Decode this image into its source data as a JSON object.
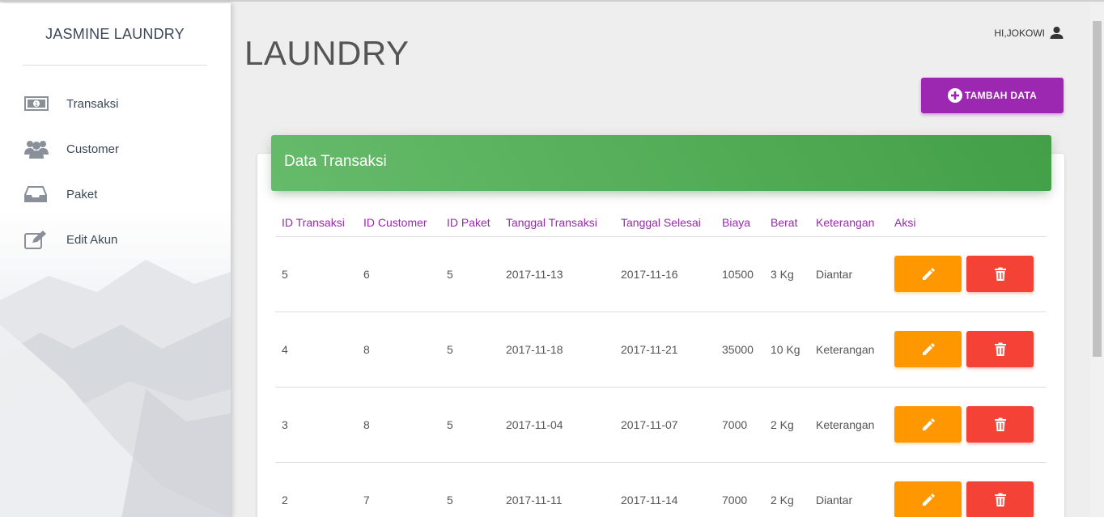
{
  "sidebar": {
    "brand": "JASMINE LAUNDRY",
    "items": [
      {
        "label": "Transaksi",
        "icon": "money-icon"
      },
      {
        "label": "Customer",
        "icon": "users-icon"
      },
      {
        "label": "Paket",
        "icon": "inbox-icon"
      },
      {
        "label": "Edit Akun",
        "icon": "edit-icon"
      }
    ]
  },
  "header": {
    "user_label": "HI,JOKOWI",
    "title": "LAUNDRY",
    "add_button": "TAMBAH DATA"
  },
  "card": {
    "title": "Data Transaksi",
    "columns": [
      "ID Transaksi",
      "ID Customer",
      "ID Paket",
      "Tanggal Transaksi",
      "Tanggal Selesai",
      "Biaya",
      "Berat",
      "Keterangan",
      "Aksi"
    ],
    "rows": [
      [
        "5",
        "6",
        "5",
        "2017-11-13",
        "2017-11-16",
        "10500",
        "3 Kg",
        "Diantar"
      ],
      [
        "4",
        "8",
        "5",
        "2017-11-18",
        "2017-11-21",
        "35000",
        "10 Kg",
        "Keterangan"
      ],
      [
        "3",
        "8",
        "5",
        "2017-11-04",
        "2017-11-07",
        "7000",
        "2 Kg",
        "Keterangan"
      ],
      [
        "2",
        "7",
        "5",
        "2017-11-11",
        "2017-11-14",
        "7000",
        "2 Kg",
        "Diantar"
      ]
    ]
  },
  "colors": {
    "primary": "#9c27b0",
    "success": "#4caf50",
    "warning": "#ff9800",
    "danger": "#f44336"
  }
}
